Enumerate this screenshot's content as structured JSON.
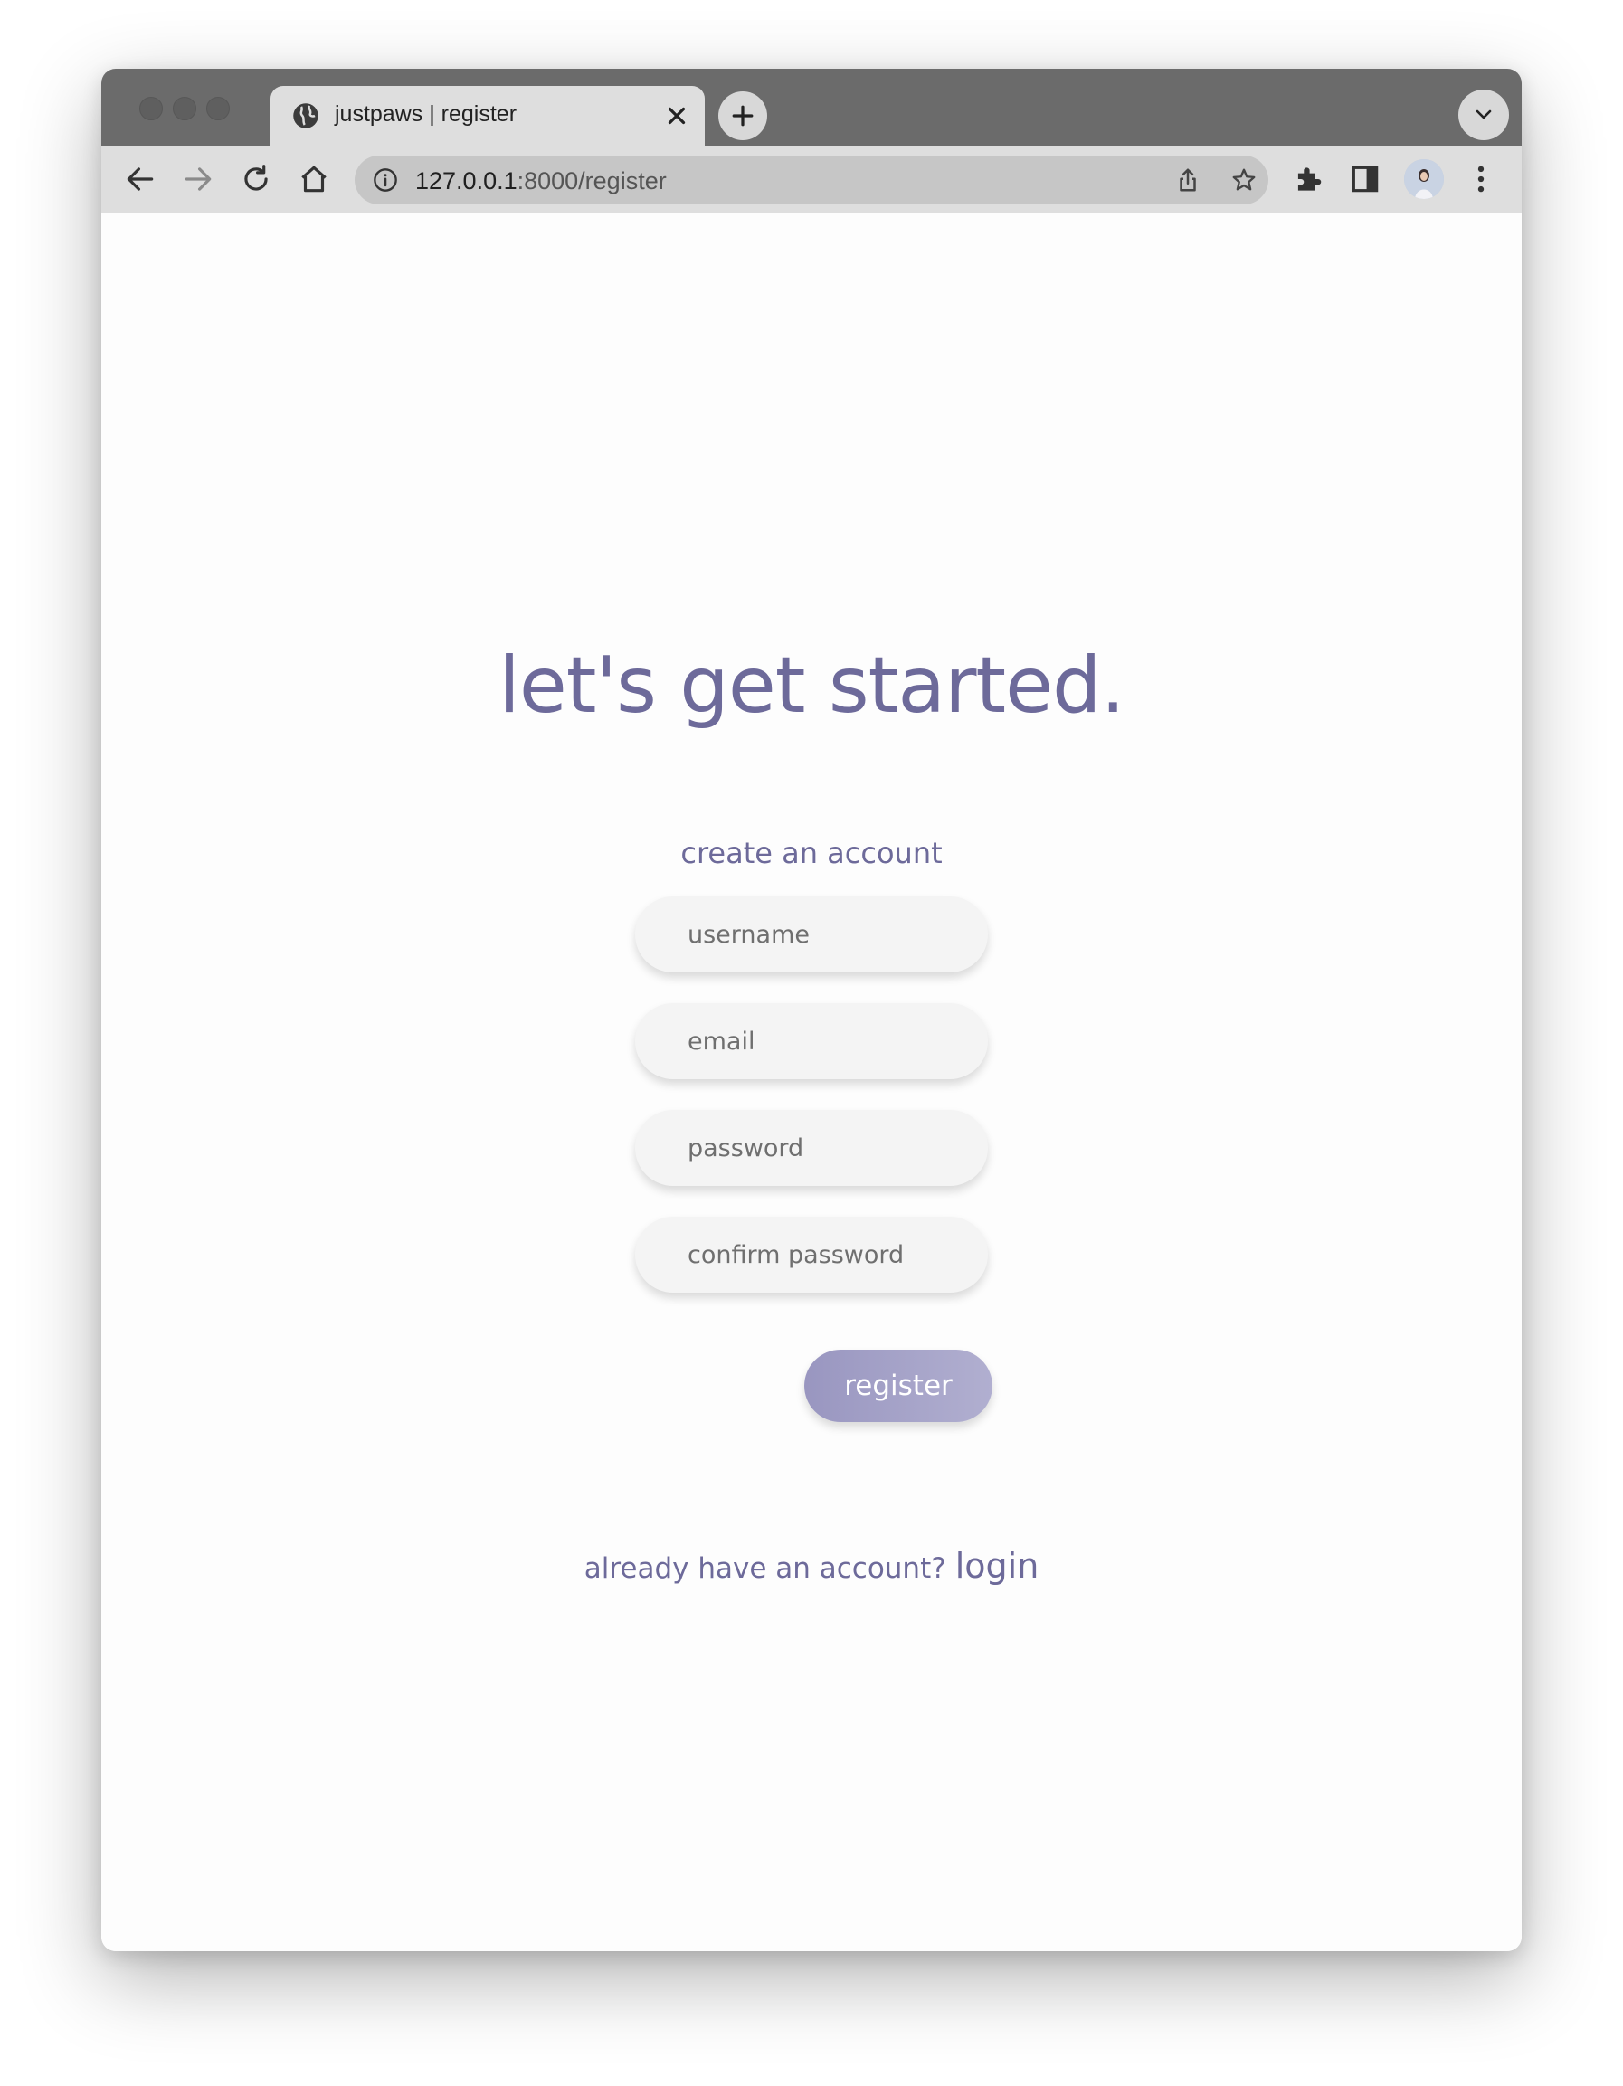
{
  "browser": {
    "tab_title": "justpaws | register",
    "url_host": "127.0.0.1",
    "url_rest": ":8000/register"
  },
  "page": {
    "heading": "let's get started.",
    "subheading": "create an account",
    "form": {
      "username_placeholder": "username",
      "email_placeholder": "email",
      "password_placeholder": "password",
      "confirm_password_placeholder": "confirm password",
      "submit_label": "register"
    },
    "footer": {
      "prompt": "already have an account?",
      "login_label": "login"
    }
  },
  "colors": {
    "accent": "#6d6a9a",
    "button_start": "#9996c0",
    "button_end": "#b1afd0",
    "field_bg": "#f4f4f4"
  }
}
